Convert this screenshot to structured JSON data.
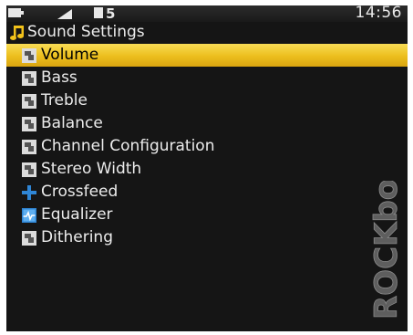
{
  "status": {
    "clock": "14:56",
    "hold_indicator": "5"
  },
  "header": {
    "title": "Sound Settings",
    "icon": "music-note-icon"
  },
  "menu": {
    "items": [
      {
        "label": "Volume",
        "icon": "setting-icon",
        "selected": true
      },
      {
        "label": "Bass",
        "icon": "setting-icon"
      },
      {
        "label": "Treble",
        "icon": "setting-icon"
      },
      {
        "label": "Balance",
        "icon": "setting-icon"
      },
      {
        "label": "Channel Configuration",
        "icon": "setting-icon"
      },
      {
        "label": "Stereo Width",
        "icon": "setting-icon"
      },
      {
        "label": "Crossfeed",
        "icon": "crossfeed-icon"
      },
      {
        "label": "Equalizer",
        "icon": "equalizer-icon"
      },
      {
        "label": "Dithering",
        "icon": "setting-icon"
      }
    ]
  },
  "branding": {
    "logo_text": "ROCKbox"
  },
  "colors": {
    "screen_background": "#151515",
    "selection_highlight": "#ecbe1d",
    "text": "#ececec",
    "accent_icon": "#2f86d6"
  }
}
